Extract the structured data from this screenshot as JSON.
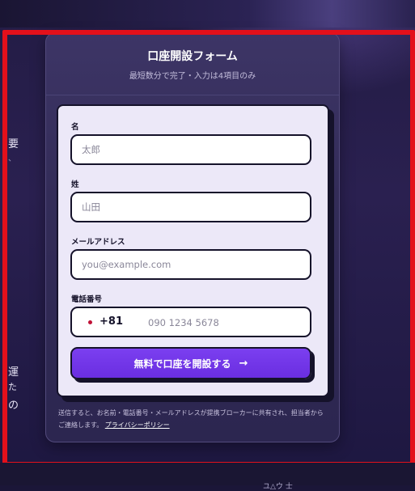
{
  "form": {
    "title": "口座開設フォーム",
    "subtitle": "最短数分で完了・入力は4項目のみ",
    "first_name": {
      "label": "名",
      "placeholder": "太郎"
    },
    "last_name": {
      "label": "姓",
      "placeholder": "山田"
    },
    "email": {
      "label": "メールアドレス",
      "placeholder": "you@example.com"
    },
    "phone": {
      "label": "電話番号",
      "country_code": "+81",
      "placeholder": "090 1234 5678"
    },
    "submit_label": "無料で口座を開設する",
    "submit_icon": "→",
    "consent_text": "送信すると、お名前・電話番号・メールアドレスが提携ブローカーに共有され、担当者からご連絡します。",
    "privacy_link": "プライバシーポリシー"
  },
  "background": {
    "side_text": [
      "要",
      "運",
      "た",
      "の"
    ],
    "bottom_text": "ユ△ウ 士"
  },
  "colors": {
    "accent": "#6a2ee0",
    "frame": "#e3101b",
    "flag": "#c01136"
  }
}
